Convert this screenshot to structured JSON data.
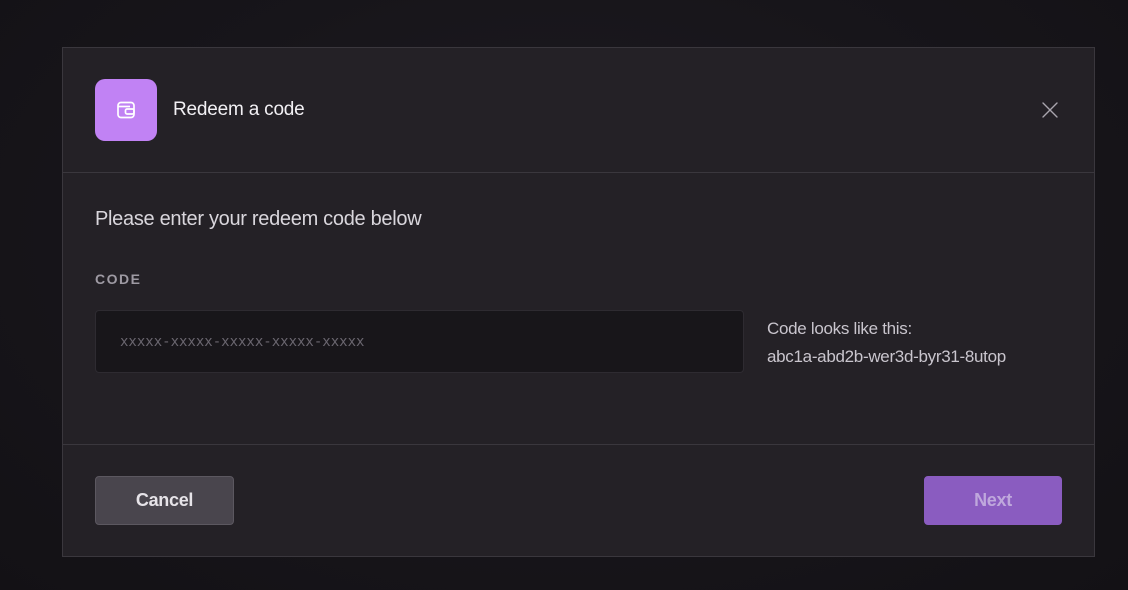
{
  "modal": {
    "title": "Redeem a code",
    "header_icon": "wallet-icon",
    "close_icon": "close-icon",
    "accent_color": "#c182f4"
  },
  "body": {
    "heading": "Please enter your redeem code below",
    "code_label": "CODE",
    "code_input": {
      "value": "",
      "placeholder": "xxxxx-xxxxx-xxxxx-xxxxx-xxxxx"
    },
    "hint_title": "Code looks like this:",
    "hint_example": "abc1a-abd2b-wer3d-byr31-8utop"
  },
  "footer": {
    "cancel_label": "Cancel",
    "next_label": "Next",
    "next_color": "#8a5cc0"
  }
}
